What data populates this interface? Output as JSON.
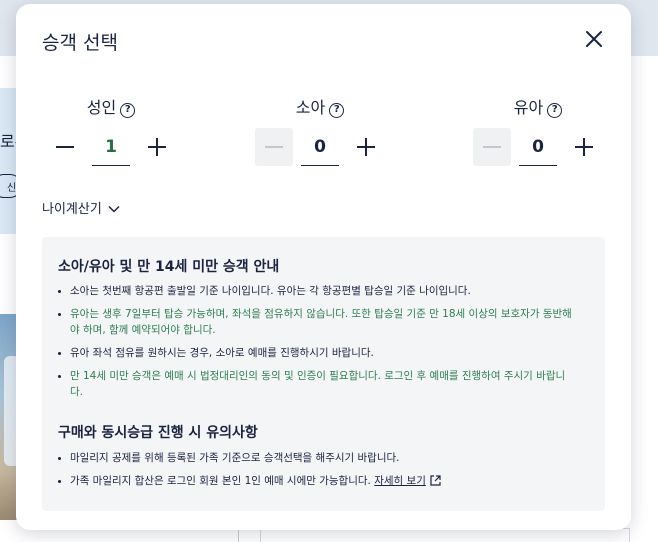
{
  "background": {
    "left_text": "로유",
    "left_chip": "신"
  },
  "modal": {
    "title": "승객 선택",
    "close_icon": "close-icon",
    "passengers": [
      {
        "label": "성인",
        "count": "1"
      },
      {
        "label": "소아",
        "count": "0"
      },
      {
        "label": "유아",
        "count": "0"
      }
    ],
    "help_symbol": "?",
    "age_calc_label": "나이계산기",
    "section1": {
      "title": "소아/유아 및 만 14세 미만 승객 안내",
      "items": [
        "소아는 첫번째 항공편 출발일 기준 나이입니다. 유아는 각 항공편별 탑승일 기준 나이입니다.",
        "유아는 생후 7일부터 탑승 가능하며, 좌석을 점유하지 않습니다. 또한 탑승일 기준 만 18세 이상의 보호자가 동반해야 하며, 함께 예약되어야 합니다.",
        "유아 좌석 점유를 원하시는 경우, 소아로 예매를 진행하시기 바랍니다.",
        "만 14세 미만 승객은 예매 시 법정대리인의 동의 및 인증이 필요합니다. 로그인 후 예매를 진행하여 주시기 바랍니다."
      ]
    },
    "section2": {
      "title": "구매와 동시승급 진행 시 유의사항",
      "items": [
        "마일리지 공제를 위해 등록된 가족 기준으로 승객선택을 해주시기 바랍니다.",
        "가족 마일리지 합산은 로그인 회원 본인 1인 예매 시에만 가능합니다."
      ],
      "link_text": "자세히 보기"
    }
  },
  "colors": {
    "navy": "#1a2340",
    "green": "#2e7d52",
    "panel": "#f4f5f7"
  }
}
